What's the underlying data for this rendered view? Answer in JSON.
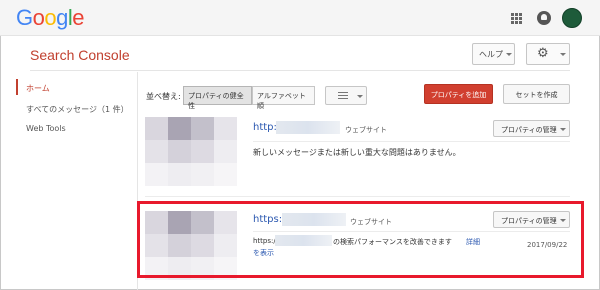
{
  "header": {
    "logo_letters": [
      {
        "char": "G",
        "color": "#4285f4"
      },
      {
        "char": "o",
        "color": "#ea4335"
      },
      {
        "char": "o",
        "color": "#fbbc05"
      },
      {
        "char": "g",
        "color": "#4285f4"
      },
      {
        "char": "l",
        "color": "#34a853"
      },
      {
        "char": "e",
        "color": "#ea4335"
      }
    ],
    "apps_icon": "apps-grid-icon",
    "notification_icon": "bell-icon",
    "avatar_color": "#1e5b3a"
  },
  "app": {
    "title": "Search Console",
    "help_label": "ヘルプ",
    "settings_icon": "gear-icon",
    "accent_color": "#c1402f"
  },
  "sidebar": {
    "items": [
      {
        "label": "ホーム",
        "active": true
      },
      {
        "label": "すべてのメッセージ（1 件）",
        "active": false
      },
      {
        "label": "Web Tools",
        "active": false
      }
    ]
  },
  "toolbar": {
    "sort_label": "並べ替え:",
    "sort_options": [
      {
        "label": "プロパティの健全性",
        "selected": true
      },
      {
        "label": "アルファベット順",
        "selected": false
      }
    ],
    "view_icon": "list-view-icon",
    "add_property_label": "プロパティを追加",
    "create_set_label": "セットを作成",
    "add_button_color": "#d13f2f"
  },
  "properties": [
    {
      "url_prefix": "http://",
      "type": "ウェブサイト",
      "manage_label": "プロパティの管理",
      "message": "新しいメッセージまたは新しい重大な問題はありません。"
    },
    {
      "url_prefix": "https://",
      "type": "ウェブサイト",
      "manage_label": "プロパティの管理",
      "message_prefix": "https://",
      "message_suffix": "の検索パフォーマンスを改善できます",
      "message_link_line1": "詳細",
      "message_link_line2": "を表示",
      "date": "2017/09/22",
      "highlight_color": "#e8192c"
    }
  ]
}
